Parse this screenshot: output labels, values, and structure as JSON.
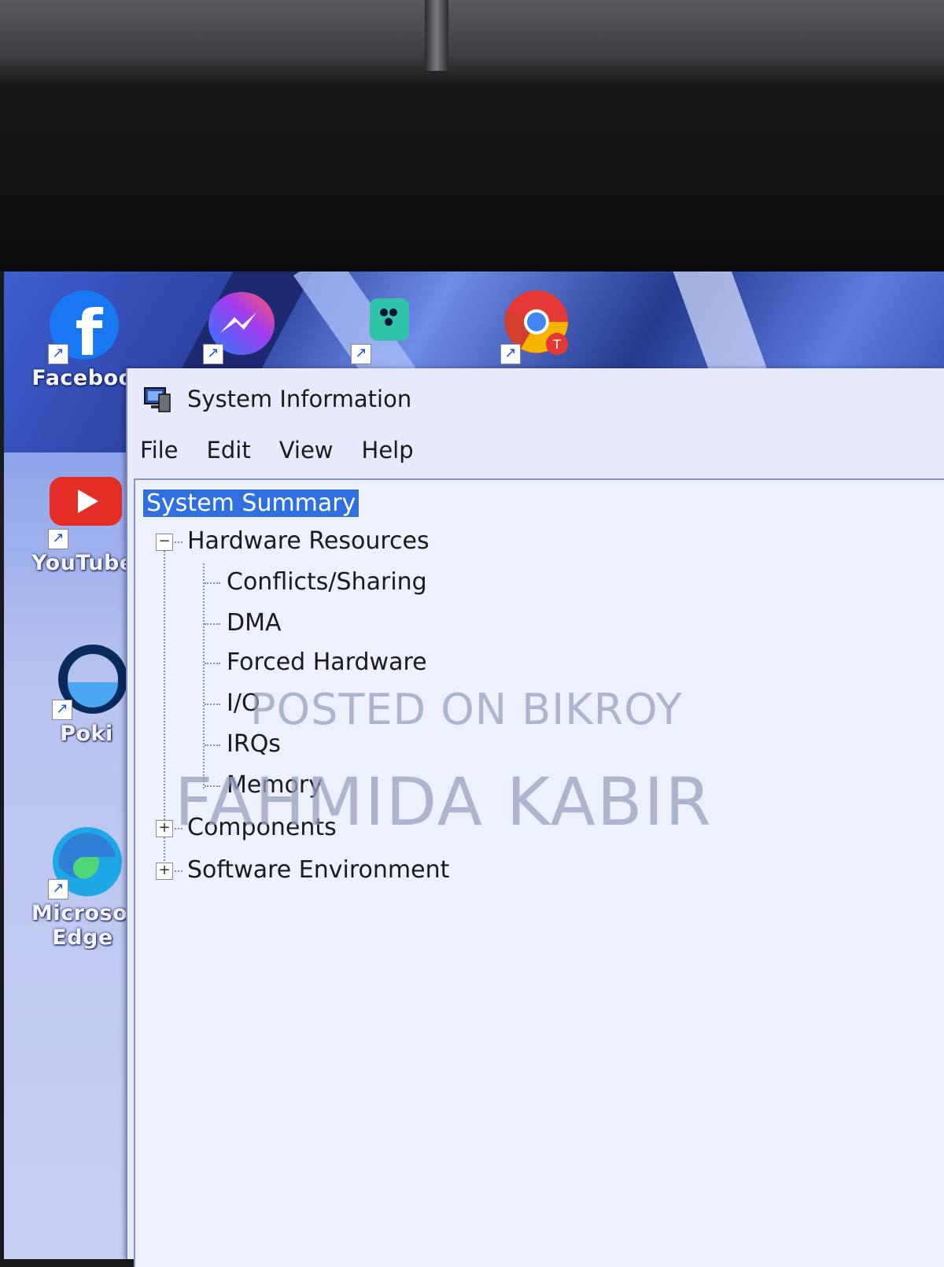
{
  "desktop": {
    "icons": [
      {
        "label": "Faceboo",
        "icon": "facebook-icon"
      },
      {
        "label": "",
        "icon": "messenger-icon"
      },
      {
        "label": "",
        "icon": "game-controller-icon"
      },
      {
        "label": "",
        "icon": "chrome-icon"
      },
      {
        "label": "YouTube",
        "icon": "youtube-icon"
      },
      {
        "label": "Poki",
        "icon": "poki-icon"
      },
      {
        "label": "Microsof",
        "icon": "edge-icon",
        "label2": "Edge"
      }
    ]
  },
  "window": {
    "title": "System Information",
    "menu": [
      "File",
      "Edit",
      "View",
      "Help"
    ],
    "tree": {
      "root": "System Summary",
      "hardware": {
        "label": "Hardware Resources",
        "expander": "−",
        "children": [
          "Conflicts/Sharing",
          "DMA",
          "Forced Hardware",
          "I/O",
          "IRQs",
          "Memory"
        ]
      },
      "components": {
        "label": "Components",
        "expander": "+"
      },
      "software": {
        "label": "Software Environment",
        "expander": "+"
      }
    }
  },
  "watermark": {
    "line1": "POSTED ON BIKROY",
    "line2": "FAHMIDA KABIR"
  },
  "colors": {
    "selection": "#2f6fe0",
    "window_bg": "#e6eafc"
  }
}
